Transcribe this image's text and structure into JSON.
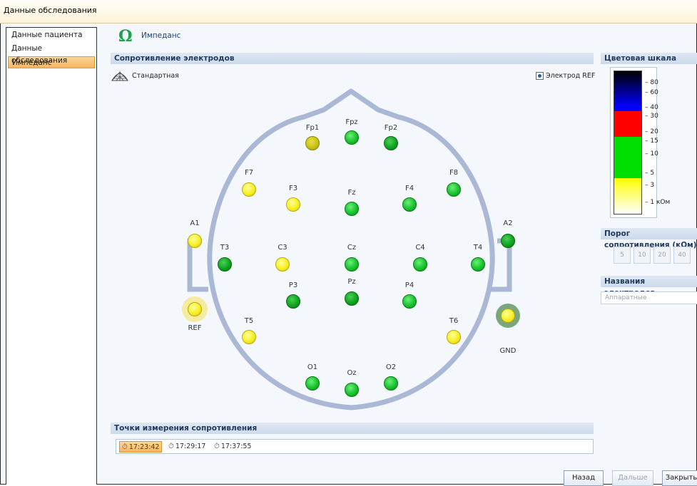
{
  "window": {
    "title": "Данные обследования"
  },
  "sidebar": {
    "items": [
      {
        "label": "Данные пациента"
      },
      {
        "label": "Данные обследования"
      },
      {
        "label": "Импеданс"
      }
    ]
  },
  "header": {
    "title": "Импеданс"
  },
  "electrodes_panel": {
    "title": "Сопротивление электродов",
    "montage_label": "Стандартная",
    "ref_toggle_label": "Электрод REF",
    "electrodes": [
      {
        "name": "Fp1",
        "status": "olive"
      },
      {
        "name": "Fpz",
        "status": "green"
      },
      {
        "name": "Fp2",
        "status": "dgreen"
      },
      {
        "name": "F7",
        "status": "yellow"
      },
      {
        "name": "F3",
        "status": "yellow"
      },
      {
        "name": "Fz",
        "status": "green"
      },
      {
        "name": "F4",
        "status": "green"
      },
      {
        "name": "F8",
        "status": "green"
      },
      {
        "name": "A1",
        "status": "yellow"
      },
      {
        "name": "A2",
        "status": "dgreen"
      },
      {
        "name": "T3",
        "status": "dgreen"
      },
      {
        "name": "C3",
        "status": "yellow"
      },
      {
        "name": "Cz",
        "status": "green"
      },
      {
        "name": "C4",
        "status": "green"
      },
      {
        "name": "T4",
        "status": "green"
      },
      {
        "name": "REF",
        "status": "yellow"
      },
      {
        "name": "T5",
        "status": "yellow"
      },
      {
        "name": "P3",
        "status": "dgreen"
      },
      {
        "name": "Pz",
        "status": "dgreen"
      },
      {
        "name": "P4",
        "status": "green"
      },
      {
        "name": "T6",
        "status": "yellow"
      },
      {
        "name": "GND",
        "status": "yellow"
      },
      {
        "name": "O1",
        "status": "green"
      },
      {
        "name": "Oz",
        "status": "green"
      },
      {
        "name": "O2",
        "status": "green"
      }
    ]
  },
  "color_scale": {
    "title": "Цветовая шкала",
    "ticks": [
      "80",
      "60",
      "40",
      "30",
      "20",
      "15",
      "10",
      "5",
      "3",
      "1 кОм"
    ],
    "colors": {
      "black": "#000000",
      "blue": "#0000ff",
      "red": "#ff0000",
      "green": "#00dd00",
      "yellow": "#ffff00",
      "white": "#ffffff"
    }
  },
  "threshold": {
    "title": "Порог сопротивления (кОм)",
    "options": [
      "5",
      "10",
      "20",
      "40"
    ]
  },
  "electrode_names": {
    "title": "Названия электродов",
    "selected": "Аппаратные"
  },
  "measurements": {
    "title": "Точки измерения сопротивления",
    "times": [
      "17:23:42",
      "17:29:17",
      "17:37:55"
    ]
  },
  "buttons": {
    "back": "Назад",
    "next": "Дальше",
    "close": "Закрыть"
  }
}
